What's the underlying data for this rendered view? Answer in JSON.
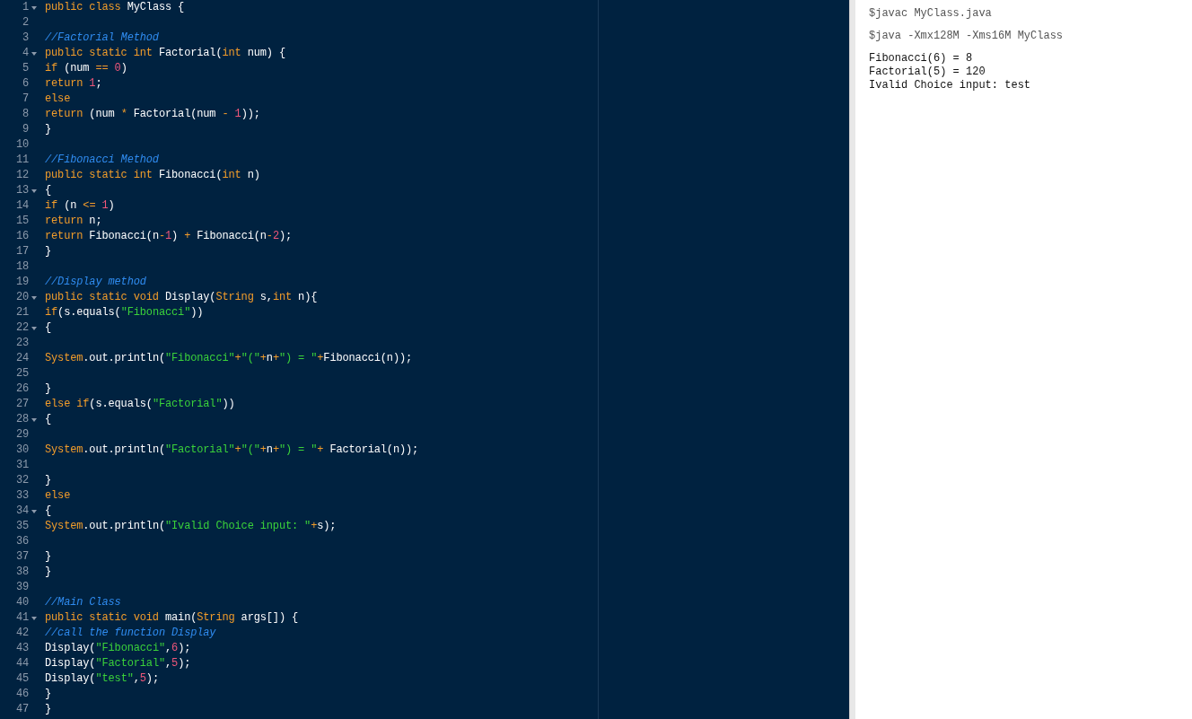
{
  "editor": {
    "lines": [
      {
        "number": "1",
        "fold": true,
        "tokens": [
          {
            "kind": "keyword",
            "text": "public class "
          },
          {
            "kind": "plain",
            "text": "MyClass {"
          }
        ]
      },
      {
        "number": "2",
        "fold": false
      },
      {
        "number": "3",
        "fold": false,
        "tokens": [
          {
            "kind": "comment",
            "text": "//Factorial Method"
          }
        ]
      },
      {
        "number": "4",
        "fold": true,
        "tokens": [
          {
            "kind": "keyword",
            "text": "public static int "
          },
          {
            "kind": "plain",
            "text": "Factorial("
          },
          {
            "kind": "keyword",
            "text": "int"
          },
          {
            "kind": "plain",
            "text": " num) {"
          }
        ]
      },
      {
        "number": "5",
        "fold": false,
        "tokens": [
          {
            "kind": "keyword",
            "text": "if"
          },
          {
            "kind": "plain",
            "text": " (num "
          },
          {
            "kind": "keyword",
            "text": "=="
          },
          {
            "kind": "number",
            "text": " 0"
          },
          {
            "kind": "plain",
            "text": ")"
          }
        ]
      },
      {
        "number": "6",
        "fold": false,
        "tokens": [
          {
            "kind": "keyword",
            "text": "return"
          },
          {
            "kind": "number",
            "text": " 1"
          },
          {
            "kind": "plain",
            "text": ";"
          }
        ]
      },
      {
        "number": "7",
        "fold": false,
        "tokens": [
          {
            "kind": "keyword",
            "text": "else"
          }
        ]
      },
      {
        "number": "8",
        "fold": false,
        "tokens": [
          {
            "kind": "keyword",
            "text": "return"
          },
          {
            "kind": "plain",
            "text": " (num "
          },
          {
            "kind": "keyword",
            "text": "*"
          },
          {
            "kind": "plain",
            "text": " Factorial(num "
          },
          {
            "kind": "keyword",
            "text": "-"
          },
          {
            "kind": "number",
            "text": " 1"
          },
          {
            "kind": "plain",
            "text": "));"
          }
        ]
      },
      {
        "number": "9",
        "fold": false,
        "tokens": [
          {
            "kind": "plain",
            "text": "}"
          }
        ]
      },
      {
        "number": "10",
        "fold": false
      },
      {
        "number": "11",
        "fold": false,
        "tokens": [
          {
            "kind": "comment",
            "text": "//Fibonacci Method"
          }
        ]
      },
      {
        "number": "12",
        "fold": false,
        "tokens": [
          {
            "kind": "keyword",
            "text": "public static int "
          },
          {
            "kind": "plain",
            "text": "Fibonacci("
          },
          {
            "kind": "keyword",
            "text": "int"
          },
          {
            "kind": "plain",
            "text": " n)"
          }
        ]
      },
      {
        "number": "13",
        "fold": true,
        "tokens": [
          {
            "kind": "plain",
            "text": "{"
          }
        ]
      },
      {
        "number": "14",
        "fold": false,
        "tokens": [
          {
            "kind": "keyword",
            "text": "if"
          },
          {
            "kind": "plain",
            "text": " (n "
          },
          {
            "kind": "keyword",
            "text": "<="
          },
          {
            "kind": "number",
            "text": " 1"
          },
          {
            "kind": "plain",
            "text": ")"
          }
        ]
      },
      {
        "number": "15",
        "fold": false,
        "tokens": [
          {
            "kind": "keyword",
            "text": "return"
          },
          {
            "kind": "plain",
            "text": " n;"
          }
        ]
      },
      {
        "number": "16",
        "fold": false,
        "tokens": [
          {
            "kind": "keyword",
            "text": "return"
          },
          {
            "kind": "plain",
            "text": " Fibonacci(n"
          },
          {
            "kind": "keyword",
            "text": "-"
          },
          {
            "kind": "number",
            "text": "1"
          },
          {
            "kind": "plain",
            "text": ") "
          },
          {
            "kind": "keyword",
            "text": "+"
          },
          {
            "kind": "plain",
            "text": " Fibonacci(n"
          },
          {
            "kind": "keyword",
            "text": "-"
          },
          {
            "kind": "number",
            "text": "2"
          },
          {
            "kind": "plain",
            "text": ");"
          }
        ]
      },
      {
        "number": "17",
        "fold": false,
        "tokens": [
          {
            "kind": "plain",
            "text": "}"
          }
        ]
      },
      {
        "number": "18",
        "fold": false
      },
      {
        "number": "19",
        "fold": false,
        "tokens": [
          {
            "kind": "comment",
            "text": "//Display method"
          }
        ]
      },
      {
        "number": "20",
        "fold": true,
        "tokens": [
          {
            "kind": "keyword",
            "text": "public static void "
          },
          {
            "kind": "plain",
            "text": "Display("
          },
          {
            "kind": "keyword",
            "text": "String"
          },
          {
            "kind": "plain",
            "text": " s,"
          },
          {
            "kind": "keyword",
            "text": "int"
          },
          {
            "kind": "plain",
            "text": " n){"
          }
        ]
      },
      {
        "number": "21",
        "fold": false,
        "tokens": [
          {
            "kind": "keyword",
            "text": "if"
          },
          {
            "kind": "plain",
            "text": "(s.equals("
          },
          {
            "kind": "string",
            "text": "\"Fibonacci\""
          },
          {
            "kind": "plain",
            "text": "))"
          }
        ]
      },
      {
        "number": "22",
        "fold": true,
        "tokens": [
          {
            "kind": "plain",
            "text": "{"
          }
        ]
      },
      {
        "number": "23",
        "fold": false
      },
      {
        "number": "24",
        "fold": false,
        "tokens": [
          {
            "kind": "keyword",
            "text": "System"
          },
          {
            "kind": "plain",
            "text": ".out.println("
          },
          {
            "kind": "string",
            "text": "\"Fibonacci\""
          },
          {
            "kind": "keyword",
            "text": "+"
          },
          {
            "kind": "string",
            "text": "\"(\""
          },
          {
            "kind": "keyword",
            "text": "+"
          },
          {
            "kind": "plain",
            "text": "n"
          },
          {
            "kind": "keyword",
            "text": "+"
          },
          {
            "kind": "string",
            "text": "\") = \""
          },
          {
            "kind": "keyword",
            "text": "+"
          },
          {
            "kind": "plain",
            "text": "Fibonacci(n));"
          }
        ]
      },
      {
        "number": "25",
        "fold": false
      },
      {
        "number": "26",
        "fold": false,
        "tokens": [
          {
            "kind": "plain",
            "text": "}"
          }
        ]
      },
      {
        "number": "27",
        "fold": false,
        "tokens": [
          {
            "kind": "keyword",
            "text": "else if"
          },
          {
            "kind": "plain",
            "text": "(s.equals("
          },
          {
            "kind": "string",
            "text": "\"Factorial\""
          },
          {
            "kind": "plain",
            "text": "))"
          }
        ]
      },
      {
        "number": "28",
        "fold": true,
        "tokens": [
          {
            "kind": "plain",
            "text": "{"
          }
        ]
      },
      {
        "number": "29",
        "fold": false
      },
      {
        "number": "30",
        "fold": false,
        "tokens": [
          {
            "kind": "keyword",
            "text": "System"
          },
          {
            "kind": "plain",
            "text": ".out.println("
          },
          {
            "kind": "string",
            "text": "\"Factorial\""
          },
          {
            "kind": "keyword",
            "text": "+"
          },
          {
            "kind": "string",
            "text": "\"(\""
          },
          {
            "kind": "keyword",
            "text": "+"
          },
          {
            "kind": "plain",
            "text": "n"
          },
          {
            "kind": "keyword",
            "text": "+"
          },
          {
            "kind": "string",
            "text": "\") = \""
          },
          {
            "kind": "keyword",
            "text": "+"
          },
          {
            "kind": "plain",
            "text": " Factorial(n));"
          }
        ]
      },
      {
        "number": "31",
        "fold": false
      },
      {
        "number": "32",
        "fold": false,
        "tokens": [
          {
            "kind": "plain",
            "text": "}"
          }
        ]
      },
      {
        "number": "33",
        "fold": false,
        "tokens": [
          {
            "kind": "keyword",
            "text": "else"
          }
        ]
      },
      {
        "number": "34",
        "fold": true,
        "tokens": [
          {
            "kind": "plain",
            "text": "{"
          }
        ]
      },
      {
        "number": "35",
        "fold": false,
        "tokens": [
          {
            "kind": "keyword",
            "text": "System"
          },
          {
            "kind": "plain",
            "text": ".out.println("
          },
          {
            "kind": "string",
            "text": "\"Ivalid Choice input: \""
          },
          {
            "kind": "keyword",
            "text": "+"
          },
          {
            "kind": "plain",
            "text": "s);"
          }
        ]
      },
      {
        "number": "36",
        "fold": false
      },
      {
        "number": "37",
        "fold": false,
        "tokens": [
          {
            "kind": "plain",
            "text": "}"
          }
        ]
      },
      {
        "number": "38",
        "fold": false,
        "tokens": [
          {
            "kind": "plain",
            "text": "}"
          }
        ]
      },
      {
        "number": "39",
        "fold": false
      },
      {
        "number": "40",
        "fold": false,
        "tokens": [
          {
            "kind": "comment",
            "text": "//Main Class"
          }
        ]
      },
      {
        "number": "41",
        "fold": true,
        "tokens": [
          {
            "kind": "keyword",
            "text": "public static void "
          },
          {
            "kind": "plain",
            "text": "main("
          },
          {
            "kind": "keyword",
            "text": "String"
          },
          {
            "kind": "plain",
            "text": " args[]) {"
          }
        ]
      },
      {
        "number": "42",
        "fold": false,
        "tokens": [
          {
            "kind": "comment",
            "text": "//call the function Display"
          }
        ]
      },
      {
        "number": "43",
        "fold": false,
        "tokens": [
          {
            "kind": "plain",
            "text": "Display("
          },
          {
            "kind": "string",
            "text": "\"Fibonacci\""
          },
          {
            "kind": "plain",
            "text": ","
          },
          {
            "kind": "number",
            "text": "6"
          },
          {
            "kind": "plain",
            "text": ");"
          }
        ]
      },
      {
        "number": "44",
        "fold": false,
        "tokens": [
          {
            "kind": "plain",
            "text": "Display("
          },
          {
            "kind": "string",
            "text": "\"Factorial\""
          },
          {
            "kind": "plain",
            "text": ","
          },
          {
            "kind": "number",
            "text": "5"
          },
          {
            "kind": "plain",
            "text": ");"
          }
        ]
      },
      {
        "number": "45",
        "fold": false,
        "tokens": [
          {
            "kind": "plain",
            "text": "Display("
          },
          {
            "kind": "string",
            "text": "\"test\""
          },
          {
            "kind": "plain",
            "text": ","
          },
          {
            "kind": "number",
            "text": "5"
          },
          {
            "kind": "plain",
            "text": ");"
          }
        ]
      },
      {
        "number": "46",
        "fold": false,
        "tokens": [
          {
            "kind": "plain",
            "text": "}"
          }
        ]
      },
      {
        "number": "47",
        "fold": false,
        "tokens": [
          {
            "kind": "plain",
            "text": "}"
          }
        ]
      }
    ]
  },
  "output": {
    "commands": [
      "$javac MyClass.java",
      "$java -Xmx128M -Xms16M MyClass"
    ],
    "lines": [
      "Fibonacci(6) = 8",
      "Factorial(5) = 120",
      "Ivalid Choice input: test"
    ]
  }
}
